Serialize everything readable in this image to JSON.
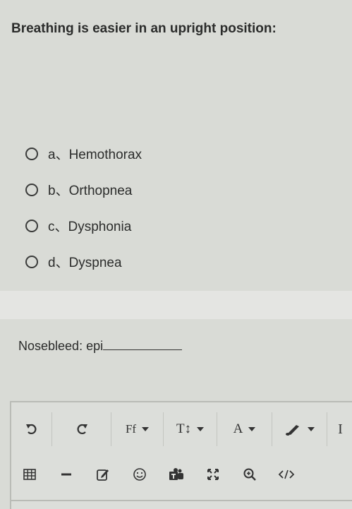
{
  "question": {
    "title": "Breathing is easier in an upright position:",
    "options": [
      {
        "label": "a、Hemothorax"
      },
      {
        "label": "b、Orthopnea"
      },
      {
        "label": "c、Dysphonia"
      },
      {
        "label": "d、Dyspnea"
      }
    ]
  },
  "fill_blank": {
    "prompt": "Nosebleed: epi"
  },
  "toolbar": {
    "font_label": "Ff",
    "size_label": "T↕",
    "color_label": "A",
    "partial_label": "I",
    "icons": [
      "undo-icon",
      "redo-icon",
      "font-family-icon",
      "font-size-icon",
      "text-color-icon",
      "highlight-icon",
      "italic-icon",
      "table-icon",
      "horizontal-rule-icon",
      "edit-icon",
      "emoji-icon",
      "teams-icon",
      "fullscreen-icon",
      "zoom-icon",
      "code-icon"
    ]
  }
}
